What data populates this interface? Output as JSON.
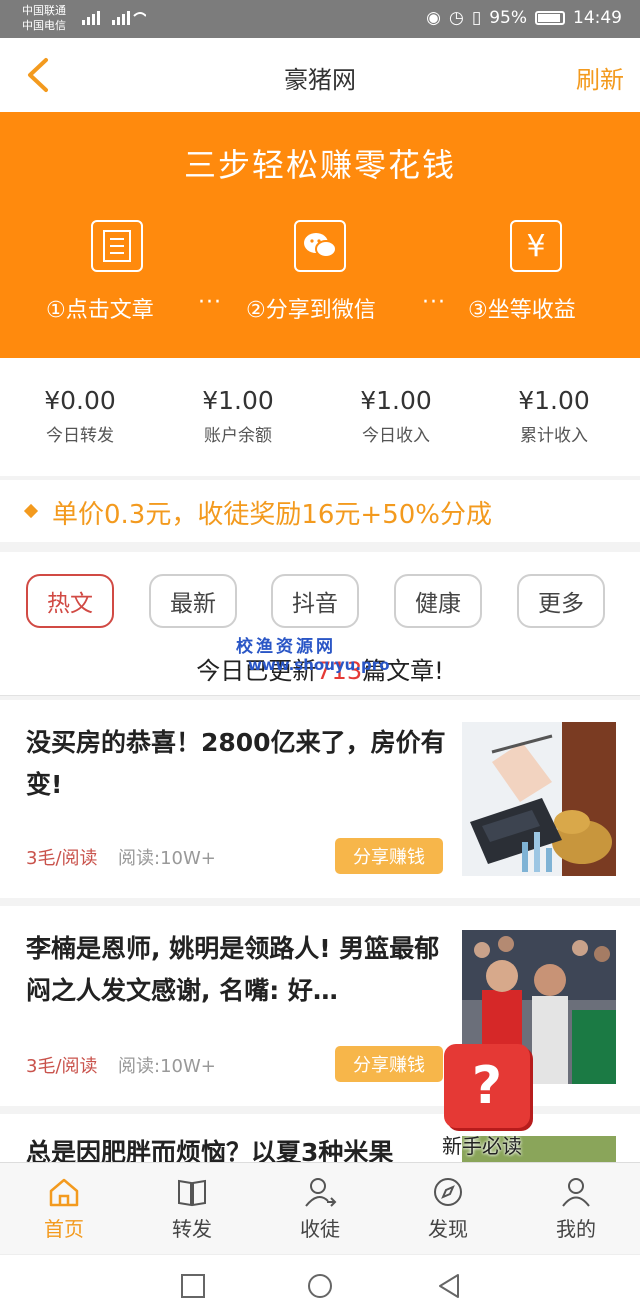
{
  "status_bar": {
    "carrier1": "中国联通",
    "carrier2": "中国电信",
    "signal": "3G 2G",
    "battery": "95%",
    "time": "14:49"
  },
  "nav": {
    "title": "豪猪网",
    "refresh_label": "刷新"
  },
  "banner": {
    "title": "三步轻松赚零花钱",
    "steps": [
      {
        "label": "①点击文章",
        "icon": "article-list-icon"
      },
      {
        "label": "②分享到微信",
        "icon": "wechat-icon"
      },
      {
        "label": "③坐等收益",
        "icon": "yuan-icon"
      }
    ],
    "dots": "···"
  },
  "stats": [
    {
      "value": "¥0.00",
      "label": "今日转发"
    },
    {
      "value": "¥1.00",
      "label": "账户余额"
    },
    {
      "value": "¥1.00",
      "label": "今日收入"
    },
    {
      "value": "¥1.00",
      "label": "累计收入"
    }
  ],
  "promo": {
    "text": "单价0.3元，收徒奖励16元+50%分成"
  },
  "tabs": [
    "热文",
    "最新",
    "抖音",
    "健康",
    "更多"
  ],
  "update": {
    "prefix": "今日已更新",
    "count": "713",
    "suffix": "篇文章!"
  },
  "watermark": {
    "line1": "校渔资源网",
    "line2": "www.shouyu.pro"
  },
  "articles": [
    {
      "title": "没买房的恭喜！2800亿来了，房价有变!",
      "price": "3毛/阅读",
      "reads": "阅读:10W+",
      "share": "分享赚钱"
    },
    {
      "title": "李楠是恩师, 姚明是领路人! 男篮最郁闷之人发文感谢, 名嘴: 好…",
      "price": "3毛/阅读",
      "reads": "阅读:10W+",
      "share": "分享赚钱"
    },
    {
      "title": "总是因肥胖而烦恼？以夏3种米果"
    }
  ],
  "help": {
    "label": "新手必读",
    "glyph": "?"
  },
  "tabbar": [
    {
      "label": "首页",
      "icon": "home-icon"
    },
    {
      "label": "转发",
      "icon": "book-icon"
    },
    {
      "label": "收徒",
      "icon": "user-add-icon"
    },
    {
      "label": "发现",
      "icon": "compass-icon"
    },
    {
      "label": "我的",
      "icon": "profile-icon"
    }
  ],
  "colors": {
    "accent": "#f39a1e",
    "banner": "#ff8a0d",
    "active_tab": "#d14a44",
    "highlight": "#e53935"
  }
}
